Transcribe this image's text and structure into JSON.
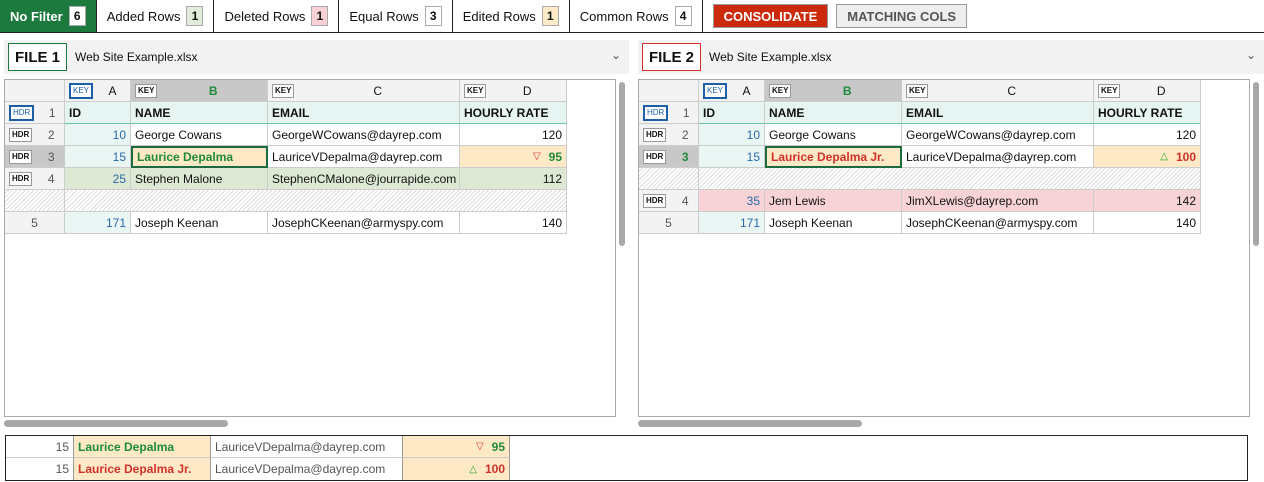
{
  "filters": [
    {
      "label": "No Filter",
      "count": "6",
      "active": true
    },
    {
      "label": "Added Rows",
      "count": "1",
      "color": "#e2ecda"
    },
    {
      "label": "Deleted Rows",
      "count": "1",
      "color": "#f8d0d6"
    },
    {
      "label": "Equal Rows",
      "count": "3",
      "color": "#ffffff"
    },
    {
      "label": "Edited Rows",
      "count": "1",
      "color": "#fdebc8"
    },
    {
      "label": "Common Rows",
      "count": "4",
      "color": "#ffffff"
    }
  ],
  "buttons": {
    "consolidate": "CONSOLIDATE",
    "matching_cols": "MATCHING COLS"
  },
  "colors": {
    "accent": "#1d7a3f",
    "consolidate": "#cc2b0b",
    "file1_border": "#1d7a3f",
    "file2_border": "#d0322a",
    "edited": "#fde9c6",
    "added": "#dde9d5",
    "deleted": "#f7d3d8"
  },
  "files": [
    {
      "label": "FILE 1",
      "name": "Web Site Example.xlsx",
      "columns": [
        {
          "key": "KEY",
          "letter": "A"
        },
        {
          "key": "KEY",
          "letter": "B"
        },
        {
          "key": "KEY",
          "letter": "C"
        },
        {
          "key": "KEY",
          "letter": "D"
        }
      ],
      "rows": [
        {
          "tag": "HDR",
          "num": "1",
          "cells": [
            "ID",
            "NAME",
            "EMAIL",
            "HOURLY RATE"
          ],
          "type": "header"
        },
        {
          "tag": "HDR",
          "num": "2",
          "cells": [
            "10",
            "George Cowans",
            "GeorgeWCowans@dayrep.com",
            "120"
          ],
          "type": "equal"
        },
        {
          "tag": "HDR",
          "num": "3",
          "cells": [
            "15",
            "Laurice Depalma",
            "LauriceVDepalma@dayrep.com",
            "95"
          ],
          "type": "edited",
          "change": "down"
        },
        {
          "tag": "HDR",
          "num": "4",
          "cells": [
            "25",
            "Stephen Malone",
            "StephenCMalone@jourrapide.com",
            "112"
          ],
          "type": "added"
        },
        {
          "type": "gap"
        },
        {
          "tag": "",
          "num": "5",
          "cells": [
            "171",
            "Joseph Keenan",
            "JosephCKeenan@armyspy.com",
            "140"
          ],
          "type": "equal"
        }
      ]
    },
    {
      "label": "FILE 2",
      "name": "Web Site Example.xlsx",
      "columns": [
        {
          "key": "KEY",
          "letter": "A"
        },
        {
          "key": "KEY",
          "letter": "B"
        },
        {
          "key": "KEY",
          "letter": "C"
        },
        {
          "key": "KEY",
          "letter": "D"
        }
      ],
      "rows": [
        {
          "tag": "HDR",
          "num": "1",
          "cells": [
            "ID",
            "NAME",
            "EMAIL",
            "HOURLY RATE"
          ],
          "type": "header"
        },
        {
          "tag": "HDR",
          "num": "2",
          "cells": [
            "10",
            "George Cowans",
            "GeorgeWCowans@dayrep.com",
            "120"
          ],
          "type": "equal"
        },
        {
          "tag": "HDR",
          "num": "3",
          "cells": [
            "15",
            "Laurice Depalma Jr.",
            "LauriceVDepalma@dayrep.com",
            "100"
          ],
          "type": "edited",
          "change": "up"
        },
        {
          "type": "gap"
        },
        {
          "tag": "HDR",
          "num": "4",
          "cells": [
            "35",
            "Jem Lewis",
            "JimXLewis@dayrep.com",
            "142"
          ],
          "type": "deleted"
        },
        {
          "tag": "",
          "num": "5",
          "cells": [
            "171",
            "Joseph Keenan",
            "JosephCKeenan@armyspy.com",
            "140"
          ],
          "type": "equal"
        }
      ]
    }
  ],
  "comparison": [
    {
      "id": "15",
      "name": "Laurice Depalma",
      "email": "LauriceVDepalma@dayrep.com",
      "rate": "95",
      "change": "down",
      "side": "file1"
    },
    {
      "id": "15",
      "name": "Laurice Depalma Jr.",
      "email": "LauriceVDepalma@dayrep.com",
      "rate": "100",
      "change": "up",
      "side": "file2"
    }
  ]
}
